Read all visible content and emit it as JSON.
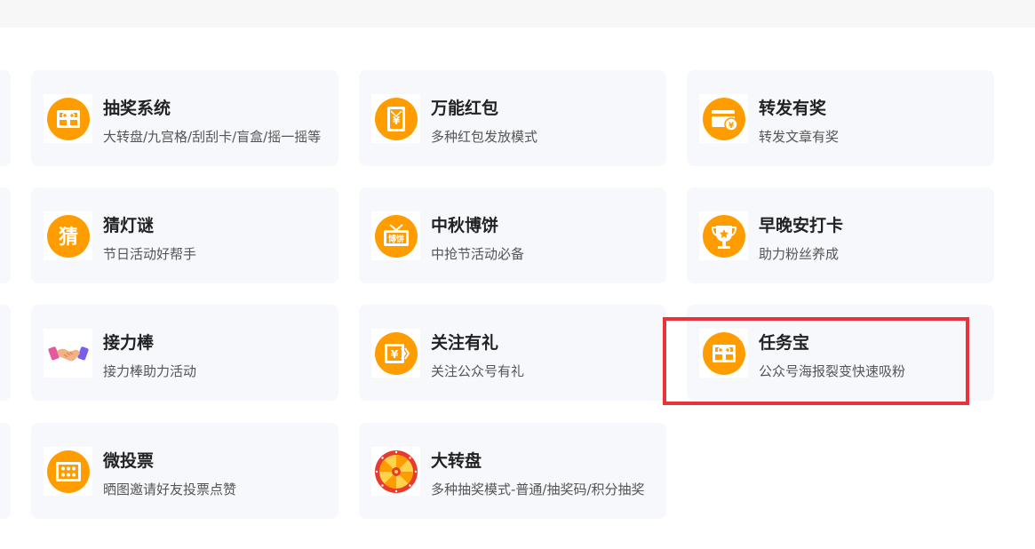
{
  "colors": {
    "accent": "#ff9d00",
    "card_bg": "#f7f8fc",
    "highlight": "#e8333a"
  },
  "cards": [
    {
      "title": "抽奖系统",
      "desc": "大转盘/九宫格/刮刮卡/盲盒/摇一摇等",
      "icon": "gift-card-icon"
    },
    {
      "title": "万能红包",
      "desc": "多种红包发放模式",
      "icon": "red-envelope-icon"
    },
    {
      "title": "转发有奖",
      "desc": "转发文章有奖",
      "icon": "yuan-card-icon"
    },
    {
      "title": "猜灯谜",
      "desc": "节日活动好帮手",
      "icon": "guess-character-icon"
    },
    {
      "title": "中秋博饼",
      "desc": "中抢节活动必备",
      "icon": "mooncake-gift-icon"
    },
    {
      "title": "早晚安打卡",
      "desc": "助力粉丝养成",
      "icon": "trophy-icon"
    },
    {
      "title": "接力棒",
      "desc": "接力棒助力活动",
      "icon": "handshake-icon"
    },
    {
      "title": "关注有礼",
      "desc": "关注公众号有礼",
      "icon": "yuan-voucher-icon"
    },
    {
      "title": "任务宝",
      "desc": "公众号海报裂变快速吸粉",
      "icon": "gift-card-icon"
    },
    {
      "title": "微投票",
      "desc": "晒图邀请好友投票点赞",
      "icon": "vote-stars-icon"
    },
    {
      "title": "大转盘",
      "desc": "多种抽奖模式-普通/抽奖码/积分抽奖",
      "icon": "prize-wheel-icon"
    }
  ],
  "icon_texts": {
    "guess": "猜",
    "mooncake": "博饼",
    "yuan": "¥"
  }
}
